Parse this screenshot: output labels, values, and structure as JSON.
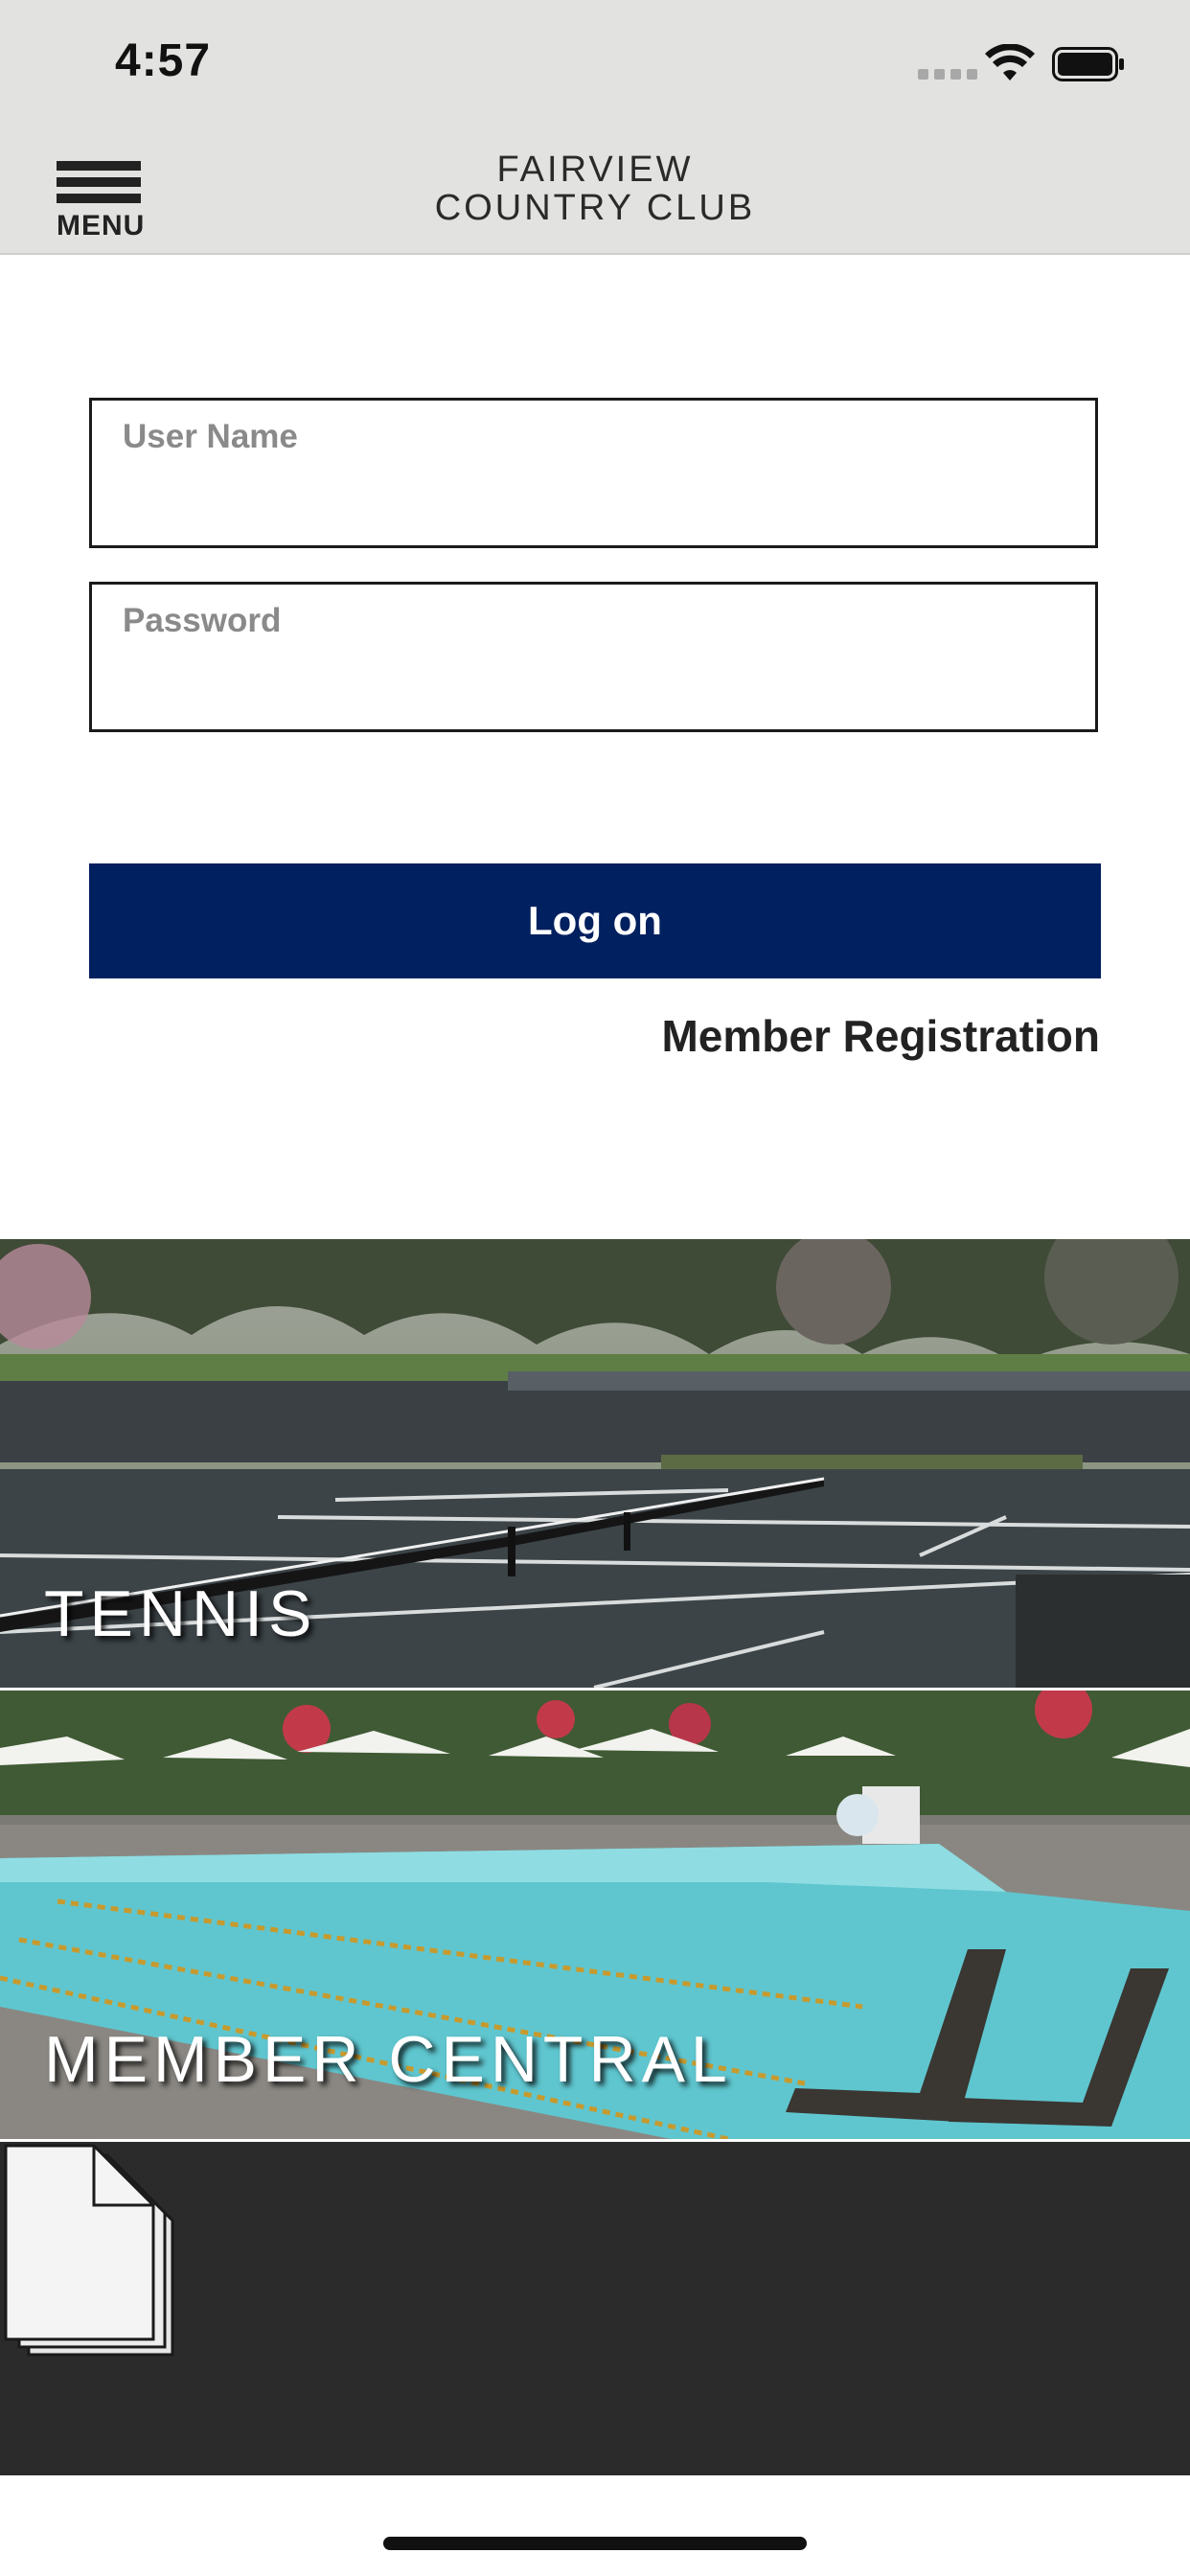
{
  "status_bar": {
    "time": "4:57"
  },
  "header": {
    "menu_label": "MENU",
    "title_line1": "FAIRVIEW",
    "title_line2": "COUNTRY CLUB"
  },
  "login": {
    "username_label": "User Name",
    "username_value": "",
    "password_label": "Password",
    "password_value": "",
    "logon_label": "Log on",
    "registration_label": "Member Registration"
  },
  "tiles": [
    {
      "label": "TENNIS"
    },
    {
      "label": "MEMBER CENTRAL"
    },
    {
      "label": ""
    }
  ],
  "colors": {
    "brand_navy": "#00205f",
    "header_bg": "#e2e2e0",
    "doc_tile_bg": "#2b2b2b"
  },
  "icons": [
    "hamburger-menu-icon",
    "wifi-icon",
    "battery-icon",
    "cellular-signal-icon",
    "document-stack-icon"
  ]
}
